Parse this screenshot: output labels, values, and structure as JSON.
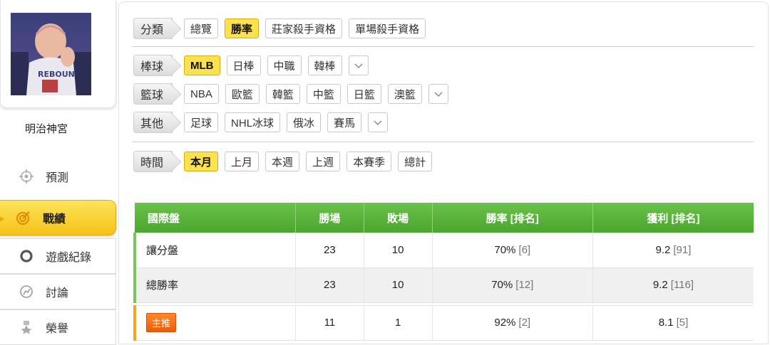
{
  "profile": {
    "username": "明治神宮"
  },
  "nav": [
    {
      "id": "predict",
      "label": "預測",
      "icon": "crosshair-icon"
    },
    {
      "id": "record",
      "label": "戰績",
      "icon": "target-icon",
      "active": true
    },
    {
      "id": "game-log",
      "label": "遊戲紀錄",
      "icon": "circle-icon"
    },
    {
      "id": "discuss",
      "label": "討論",
      "icon": "chat-icon"
    },
    {
      "id": "honor",
      "label": "榮譽",
      "icon": "medal-icon"
    }
  ],
  "filters": {
    "category": {
      "label": "分類",
      "options": [
        "總覽",
        "勝率",
        "莊家殺手資格",
        "單場殺手資格"
      ],
      "selected": "勝率"
    },
    "baseball": {
      "label": "棒球",
      "options": [
        "MLB",
        "日棒",
        "中職",
        "韓棒"
      ],
      "selected": "MLB"
    },
    "basketball": {
      "label": "籃球",
      "options": [
        "NBA",
        "歐籃",
        "韓籃",
        "中籃",
        "日籃",
        "澳籃"
      ]
    },
    "other": {
      "label": "其他",
      "options": [
        "足球",
        "NHL冰球",
        "俄冰",
        "賽馬"
      ]
    },
    "time": {
      "label": "時間",
      "options": [
        "本月",
        "上月",
        "本週",
        "上週",
        "本賽季",
        "總計"
      ],
      "selected": "本月"
    }
  },
  "table": {
    "headers": [
      "國際盤",
      "勝場",
      "敗場",
      "勝率 [排名]",
      "獲利 [排名]"
    ],
    "rows": [
      {
        "name": "讓分盤",
        "wins": "23",
        "losses": "10",
        "rate": "70%",
        "rate_rank": "[6]",
        "profit": "9.2",
        "profit_rank": "[91]"
      },
      {
        "name": "總勝率",
        "wins": "23",
        "losses": "10",
        "rate": "70%",
        "rate_rank": "[12]",
        "profit": "9.2",
        "profit_rank": "[116]"
      }
    ],
    "promo": {
      "badge": "主推",
      "wins": "11",
      "losses": "1",
      "rate": "92%",
      "rate_rank": "[2]",
      "profit": "8.1",
      "profit_rank": "[5]"
    }
  },
  "colors": {
    "accent": "#fde24f",
    "header_green": "#5ab53a",
    "promo_orange": "#f07a1f"
  }
}
